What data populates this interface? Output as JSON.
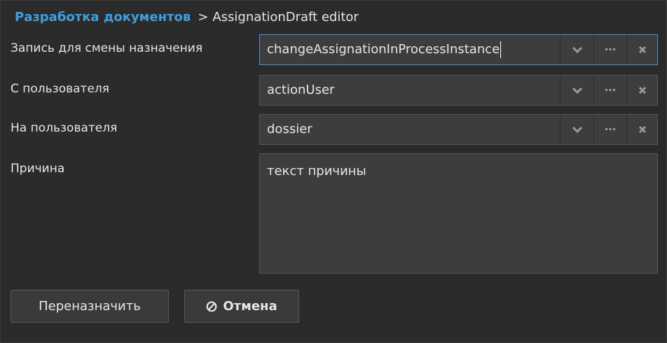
{
  "breadcrumb": {
    "link": "Разработка документов",
    "separator": ">",
    "current": "AssignationDraft editor"
  },
  "fields": {
    "record": {
      "label": "Запись для смены назначения",
      "value": "changeAssignationInProcessInstance"
    },
    "from_user": {
      "label": "С пользователя",
      "value": "actionUser"
    },
    "to_user": {
      "label": "На пользователя",
      "value": "dossier"
    },
    "reason": {
      "label": "Причина",
      "value": "текст причины"
    }
  },
  "buttons": {
    "reassign": "Переназначить",
    "cancel": "Отмена"
  },
  "icons": {
    "dropdown": "chevron-down-icon",
    "more": "ellipsis-icon",
    "clear": "close-icon",
    "cancel": "cancel-icon"
  },
  "colors": {
    "background": "#2b2b2b",
    "link": "#3f9fe0",
    "focus_border": "#4a90d9",
    "field_bg": "#3d3d3d"
  }
}
